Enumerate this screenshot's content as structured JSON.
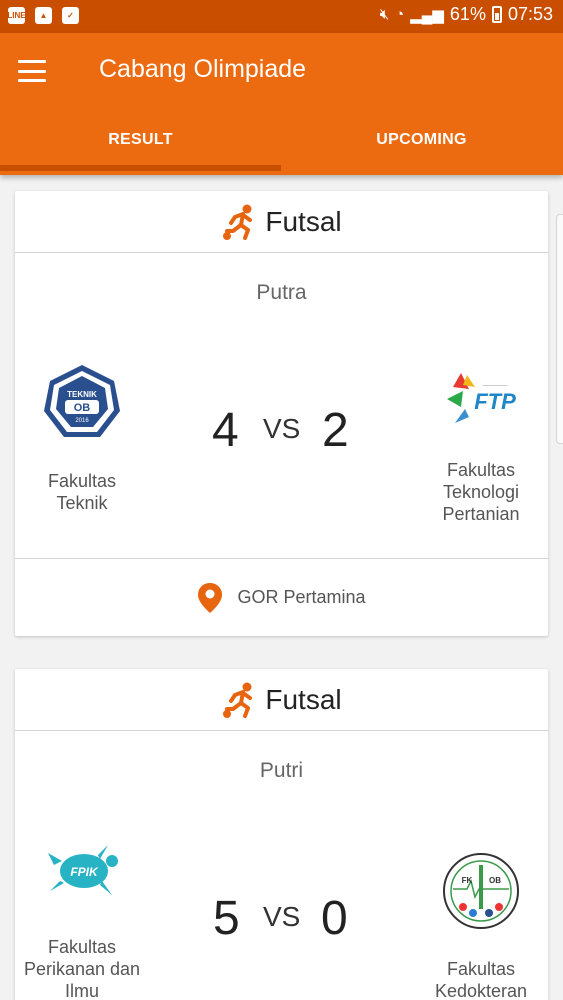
{
  "status_bar": {
    "left_icons": [
      "line-app-icon",
      "image-icon",
      "clipboard-check-icon"
    ],
    "battery_percent": "61%",
    "time": "07:53",
    "right_icons": [
      "mute-icon",
      "wifi-icon",
      "signal-icon",
      "battery-charging-icon"
    ]
  },
  "app_bar": {
    "title": "Cabang Olimpiade",
    "tabs": [
      {
        "label": "RESULT",
        "active": true
      },
      {
        "label": "UPCOMING",
        "active": false
      }
    ]
  },
  "matches": [
    {
      "sport": "Futsal",
      "category": "Putra",
      "home": {
        "name": "Fakultas Teknik",
        "logo": "teknik-ob-logo",
        "logo_text": "TEKNIK OB 2016",
        "score": "4"
      },
      "vs_label": "VS",
      "away": {
        "name": "Fakultas Teknologi Pertanian",
        "logo": "ftp-logo",
        "logo_text": "FTP",
        "score": "2"
      },
      "venue": "GOR Pertamina"
    },
    {
      "sport": "Futsal",
      "category": "Putri",
      "home": {
        "name": "Fakultas Perikanan dan Ilmu",
        "logo": "fpik-turtle-logo",
        "logo_text": "FPIK",
        "score": "5"
      },
      "vs_label": "VS",
      "away": {
        "name": "Fakultas Kedokteran",
        "logo": "fk-ob-logo",
        "logo_text": "FK OB",
        "score": "0"
      }
    }
  ],
  "colors": {
    "primary": "#ec6a10",
    "status_bar": "#c94e00",
    "background": "#f2f2f2"
  }
}
